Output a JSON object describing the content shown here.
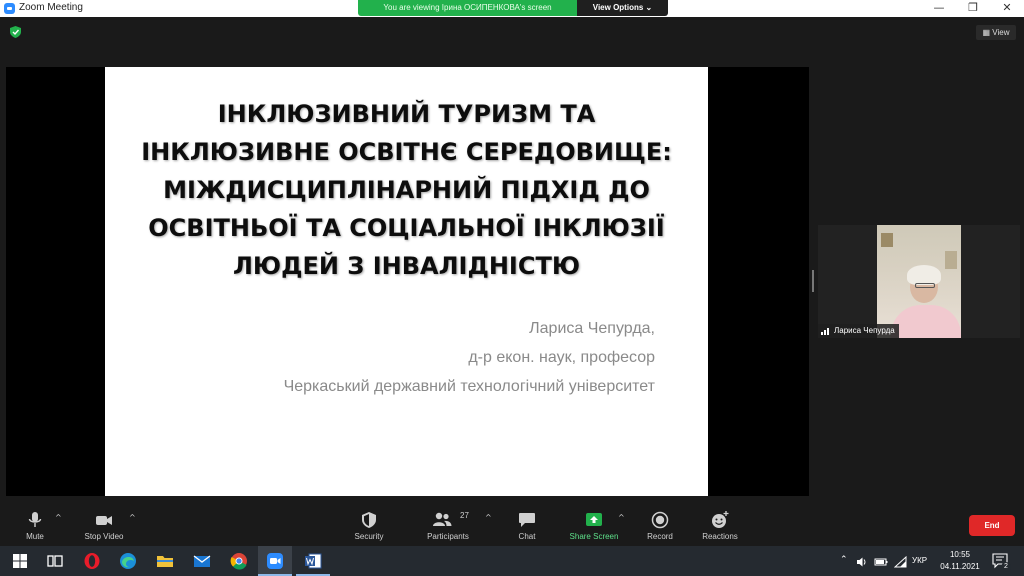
{
  "window": {
    "title": "Zoom Meeting",
    "controls": {
      "minimize": "—",
      "restore": "❐",
      "close": "✕"
    }
  },
  "banner": {
    "viewing_text": "You are viewing Ірина ОСИПЕНКОВА's screen",
    "view_options_label": "View Options ⌄"
  },
  "meeting": {
    "view_button_label": "▦ View",
    "security_color": "#22b14c"
  },
  "slide": {
    "title_lines": [
      "ІНКЛЮЗИВНИЙ ТУРИЗМ ТА",
      "ІНКЛЮЗИВНЕ ОСВІТНЄ СЕРЕДОВИЩЕ:",
      "МІЖДИСЦИПЛІНАРНИЙ ПІДХІД ДО",
      "ОСВІТНЬОЇ ТА СОЦІАЛЬНОЇ ІНКЛЮЗІЇ",
      "ЛЮДЕЙ З ІНВАЛІДНІСТЮ"
    ],
    "author": "Лариса Чепурда,",
    "degree": "д-р екон. наук, професор",
    "institution": "Черкаський державний технологічний університет"
  },
  "participant": {
    "name": "Лариса Чепурда"
  },
  "toolbar": {
    "mute": "Mute",
    "stop_video": "Stop Video",
    "security": "Security",
    "participants": "Participants",
    "participants_count": "27",
    "chat": "Chat",
    "share_screen": "Share Screen",
    "record": "Record",
    "reactions": "Reactions",
    "end": "End",
    "caret": "^",
    "share_color": "#22b14c",
    "end_color": "#e02828"
  },
  "taskbar": {
    "language": "УКР",
    "time": "10:55",
    "date": "04.11.2021",
    "notifications": "2"
  }
}
